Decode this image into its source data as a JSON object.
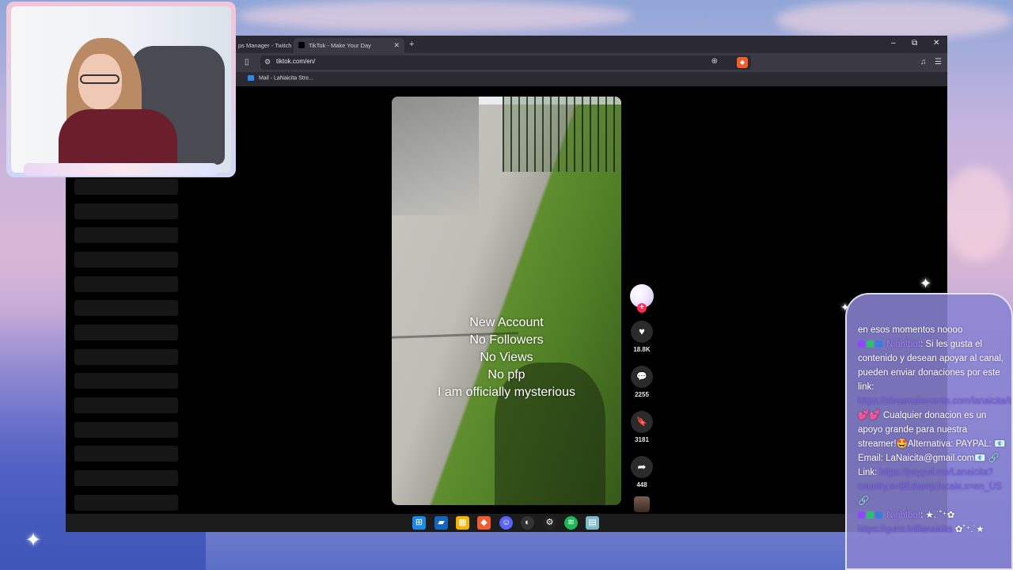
{
  "browser": {
    "tabs": [
      {
        "label": "ps Manager - Twitch",
        "active": false
      },
      {
        "label": "TikTok - Make Your Day",
        "active": true
      }
    ],
    "new_tab": "+",
    "window_controls": {
      "minimize": "–",
      "maximize": "⧉",
      "close": "✕"
    },
    "url": "tiktok.com/en/",
    "bookmark": "Mail - LaNaicita Stre..."
  },
  "video": {
    "caption_lines": [
      "New Account",
      "No Followers",
      "No Views",
      "No pfp",
      "I am officially mysterious"
    ],
    "likes": "18.8K",
    "comments": "2255",
    "saves": "3181",
    "shares": "448"
  },
  "chat": {
    "messages": [
      {
        "text": "en esos momentos noooo"
      },
      {
        "user": "Nightbot",
        "text": ": Si les gusta el contenido y desean apoyar al canal, pueden enviar donaciones por este link: "
      },
      {
        "link": "https://streamelements.com/lanaicita/tip"
      },
      {
        "text": " 💕💕 Cualquier donacion es un apoyo grande para nuestra streamer!🤩Alternativa: PAYPAL: 📧 Email: LaNaicita@gmail.com📧 🔗 Link: "
      },
      {
        "link": "https://paypal.me/Lanaicita?country.x=BE&amp;locale.x=en_US"
      },
      {
        "text": " 🔗"
      },
      {
        "user": "Nightbot",
        "text": ": ★.˙˚⁺✿"
      },
      {
        "link": "https://guns.lol/lanaicita"
      },
      {
        "text": " ✿˚⁺.˙★"
      }
    ]
  },
  "colors": {
    "tiktok_red": "#fe2c55",
    "brave_orange": "#f25b2a",
    "chat_panel": "#8983d2",
    "chat_user": "#a67bf0"
  },
  "icons": {
    "like": "♥",
    "comment": "💬",
    "save": "🔖",
    "share": "➦"
  }
}
